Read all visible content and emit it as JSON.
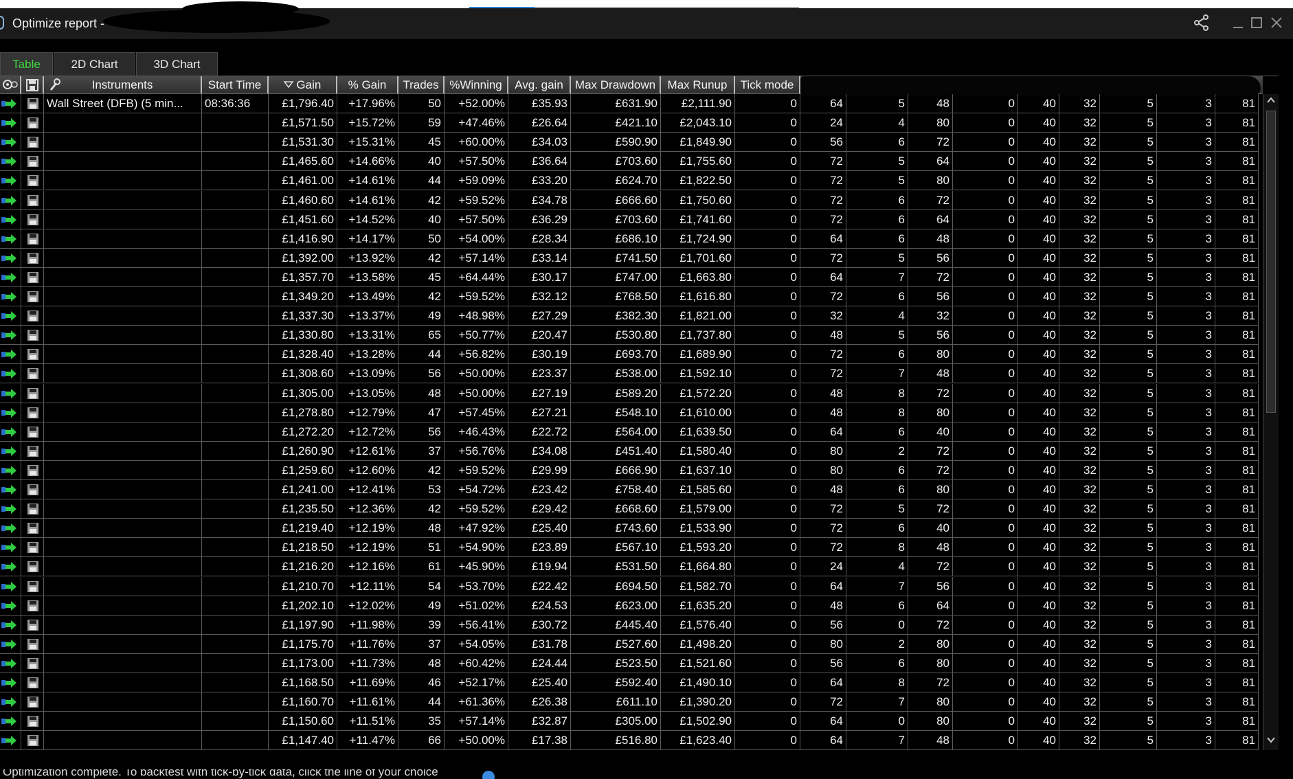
{
  "window": {
    "title": "Optimize report - "
  },
  "tabs": [
    {
      "label": "Table",
      "active": true
    },
    {
      "label": "2D Chart",
      "active": false
    },
    {
      "label": "3D Chart",
      "active": false
    }
  ],
  "columns": {
    "instruments": "Instruments",
    "start_time": "Start Time",
    "gain": "Gain",
    "pct_gain": "% Gain",
    "trades": "Trades",
    "pct_winning": "%Winning",
    "avg_gain": "Avg. gain",
    "max_drawdown": "Max Drawdown",
    "max_runup": "Max Runup",
    "tick_mode": "Tick mode"
  },
  "sort": {
    "column": "Gain",
    "direction": "descending"
  },
  "rows": [
    [
      "Wall Street (DFB) (5 min...",
      "08:36:36",
      "£1,796.40",
      "+17.96%",
      "50",
      "+52.00%",
      "£35.93",
      "£631.90",
      "£2,111.90",
      "0",
      "64",
      "5",
      "48",
      "0",
      "40",
      "32",
      "5",
      "3",
      "81"
    ],
    [
      "",
      "",
      "£1,571.50",
      "+15.72%",
      "59",
      "+47.46%",
      "£26.64",
      "£421.10",
      "£2,043.10",
      "0",
      "24",
      "4",
      "80",
      "0",
      "40",
      "32",
      "5",
      "3",
      "81"
    ],
    [
      "",
      "",
      "£1,531.30",
      "+15.31%",
      "45",
      "+60.00%",
      "£34.03",
      "£590.90",
      "£1,849.90",
      "0",
      "56",
      "6",
      "72",
      "0",
      "40",
      "32",
      "5",
      "3",
      "81"
    ],
    [
      "",
      "",
      "£1,465.60",
      "+14.66%",
      "40",
      "+57.50%",
      "£36.64",
      "£703.60",
      "£1,755.60",
      "0",
      "72",
      "5",
      "64",
      "0",
      "40",
      "32",
      "5",
      "3",
      "81"
    ],
    [
      "",
      "",
      "£1,461.00",
      "+14.61%",
      "44",
      "+59.09%",
      "£33.20",
      "£624.70",
      "£1,822.50",
      "0",
      "72",
      "5",
      "80",
      "0",
      "40",
      "32",
      "5",
      "3",
      "81"
    ],
    [
      "",
      "",
      "£1,460.60",
      "+14.61%",
      "42",
      "+59.52%",
      "£34.78",
      "£666.60",
      "£1,750.60",
      "0",
      "72",
      "6",
      "72",
      "0",
      "40",
      "32",
      "5",
      "3",
      "81"
    ],
    [
      "",
      "",
      "£1,451.60",
      "+14.52%",
      "40",
      "+57.50%",
      "£36.29",
      "£703.60",
      "£1,741.60",
      "0",
      "72",
      "6",
      "64",
      "0",
      "40",
      "32",
      "5",
      "3",
      "81"
    ],
    [
      "",
      "",
      "£1,416.90",
      "+14.17%",
      "50",
      "+54.00%",
      "£28.34",
      "£686.10",
      "£1,724.90",
      "0",
      "64",
      "6",
      "48",
      "0",
      "40",
      "32",
      "5",
      "3",
      "81"
    ],
    [
      "",
      "",
      "£1,392.00",
      "+13.92%",
      "42",
      "+57.14%",
      "£33.14",
      "£741.50",
      "£1,701.60",
      "0",
      "72",
      "5",
      "56",
      "0",
      "40",
      "32",
      "5",
      "3",
      "81"
    ],
    [
      "",
      "",
      "£1,357.70",
      "+13.58%",
      "45",
      "+64.44%",
      "£30.17",
      "£747.00",
      "£1,663.80",
      "0",
      "64",
      "7",
      "72",
      "0",
      "40",
      "32",
      "5",
      "3",
      "81"
    ],
    [
      "",
      "",
      "£1,349.20",
      "+13.49%",
      "42",
      "+59.52%",
      "£32.12",
      "£768.50",
      "£1,616.80",
      "0",
      "72",
      "6",
      "56",
      "0",
      "40",
      "32",
      "5",
      "3",
      "81"
    ],
    [
      "",
      "",
      "£1,337.30",
      "+13.37%",
      "49",
      "+48.98%",
      "£27.29",
      "£382.30",
      "£1,821.00",
      "0",
      "32",
      "4",
      "32",
      "0",
      "40",
      "32",
      "5",
      "3",
      "81"
    ],
    [
      "",
      "",
      "£1,330.80",
      "+13.31%",
      "65",
      "+50.77%",
      "£20.47",
      "£530.80",
      "£1,737.80",
      "0",
      "48",
      "5",
      "56",
      "0",
      "40",
      "32",
      "5",
      "3",
      "81"
    ],
    [
      "",
      "",
      "£1,328.40",
      "+13.28%",
      "44",
      "+56.82%",
      "£30.19",
      "£693.70",
      "£1,689.90",
      "0",
      "72",
      "6",
      "80",
      "0",
      "40",
      "32",
      "5",
      "3",
      "81"
    ],
    [
      "",
      "",
      "£1,308.60",
      "+13.09%",
      "56",
      "+50.00%",
      "£23.37",
      "£538.00",
      "£1,592.10",
      "0",
      "72",
      "7",
      "48",
      "0",
      "40",
      "32",
      "5",
      "3",
      "81"
    ],
    [
      "",
      "",
      "£1,305.00",
      "+13.05%",
      "48",
      "+50.00%",
      "£27.19",
      "£589.20",
      "£1,572.20",
      "0",
      "48",
      "8",
      "72",
      "0",
      "40",
      "32",
      "5",
      "3",
      "81"
    ],
    [
      "",
      "",
      "£1,278.80",
      "+12.79%",
      "47",
      "+57.45%",
      "£27.21",
      "£548.10",
      "£1,610.00",
      "0",
      "48",
      "8",
      "80",
      "0",
      "40",
      "32",
      "5",
      "3",
      "81"
    ],
    [
      "",
      "",
      "£1,272.20",
      "+12.72%",
      "56",
      "+46.43%",
      "£22.72",
      "£564.00",
      "£1,639.50",
      "0",
      "64",
      "6",
      "40",
      "0",
      "40",
      "32",
      "5",
      "3",
      "81"
    ],
    [
      "",
      "",
      "£1,260.90",
      "+12.61%",
      "37",
      "+56.76%",
      "£34.08",
      "£451.40",
      "£1,580.40",
      "0",
      "80",
      "2",
      "72",
      "0",
      "40",
      "32",
      "5",
      "3",
      "81"
    ],
    [
      "",
      "",
      "£1,259.60",
      "+12.60%",
      "42",
      "+59.52%",
      "£29.99",
      "£666.90",
      "£1,637.10",
      "0",
      "80",
      "6",
      "72",
      "0",
      "40",
      "32",
      "5",
      "3",
      "81"
    ],
    [
      "",
      "",
      "£1,241.00",
      "+12.41%",
      "53",
      "+54.72%",
      "£23.42",
      "£758.40",
      "£1,585.60",
      "0",
      "48",
      "6",
      "80",
      "0",
      "40",
      "32",
      "5",
      "3",
      "81"
    ],
    [
      "",
      "",
      "£1,235.50",
      "+12.36%",
      "42",
      "+59.52%",
      "£29.42",
      "£668.60",
      "£1,579.00",
      "0",
      "72",
      "5",
      "72",
      "0",
      "40",
      "32",
      "5",
      "3",
      "81"
    ],
    [
      "",
      "",
      "£1,219.40",
      "+12.19%",
      "48",
      "+47.92%",
      "£25.40",
      "£743.60",
      "£1,533.90",
      "0",
      "72",
      "6",
      "40",
      "0",
      "40",
      "32",
      "5",
      "3",
      "81"
    ],
    [
      "",
      "",
      "£1,218.50",
      "+12.19%",
      "51",
      "+54.90%",
      "£23.89",
      "£567.10",
      "£1,593.20",
      "0",
      "72",
      "8",
      "48",
      "0",
      "40",
      "32",
      "5",
      "3",
      "81"
    ],
    [
      "",
      "",
      "£1,216.20",
      "+12.16%",
      "61",
      "+45.90%",
      "£19.94",
      "£531.50",
      "£1,664.80",
      "0",
      "24",
      "4",
      "72",
      "0",
      "40",
      "32",
      "5",
      "3",
      "81"
    ],
    [
      "",
      "",
      "£1,210.70",
      "+12.11%",
      "54",
      "+53.70%",
      "£22.42",
      "£694.50",
      "£1,582.70",
      "0",
      "64",
      "7",
      "56",
      "0",
      "40",
      "32",
      "5",
      "3",
      "81"
    ],
    [
      "",
      "",
      "£1,202.10",
      "+12.02%",
      "49",
      "+51.02%",
      "£24.53",
      "£623.00",
      "£1,635.20",
      "0",
      "48",
      "6",
      "64",
      "0",
      "40",
      "32",
      "5",
      "3",
      "81"
    ],
    [
      "",
      "",
      "£1,197.90",
      "+11.98%",
      "39",
      "+56.41%",
      "£30.72",
      "£445.40",
      "£1,576.40",
      "0",
      "56",
      "0",
      "72",
      "0",
      "40",
      "32",
      "5",
      "3",
      "81"
    ],
    [
      "",
      "",
      "£1,175.70",
      "+11.76%",
      "37",
      "+54.05%",
      "£31.78",
      "£527.60",
      "£1,498.20",
      "0",
      "80",
      "2",
      "80",
      "0",
      "40",
      "32",
      "5",
      "3",
      "81"
    ],
    [
      "",
      "",
      "£1,173.00",
      "+11.73%",
      "48",
      "+60.42%",
      "£24.44",
      "£523.50",
      "£1,521.60",
      "0",
      "56",
      "6",
      "80",
      "0",
      "40",
      "32",
      "5",
      "3",
      "81"
    ],
    [
      "",
      "",
      "£1,168.50",
      "+11.69%",
      "46",
      "+52.17%",
      "£25.40",
      "£592.40",
      "£1,490.10",
      "0",
      "64",
      "8",
      "72",
      "0",
      "40",
      "32",
      "5",
      "3",
      "81"
    ],
    [
      "",
      "",
      "£1,160.70",
      "+11.61%",
      "44",
      "+61.36%",
      "£26.38",
      "£611.10",
      "£1,390.20",
      "0",
      "72",
      "7",
      "80",
      "0",
      "40",
      "32",
      "5",
      "3",
      "81"
    ],
    [
      "",
      "",
      "£1,150.60",
      "+11.51%",
      "35",
      "+57.14%",
      "£32.87",
      "£305.00",
      "£1,502.90",
      "0",
      "64",
      "0",
      "80",
      "0",
      "40",
      "32",
      "5",
      "3",
      "81"
    ],
    [
      "",
      "",
      "£1,147.40",
      "+11.47%",
      "66",
      "+50.00%",
      "£17.38",
      "£516.80",
      "£1,623.40",
      "0",
      "64",
      "7",
      "48",
      "0",
      "40",
      "32",
      "5",
      "3",
      "81"
    ]
  ],
  "status": {
    "text": "Optimization complete.   To backtest with tick-by-tick data, click the line of your choice"
  },
  "colors": {
    "active_tab_text": "#3ddc3d",
    "go_arrow": "#2ecc40",
    "background": "#000000"
  },
  "icons": {
    "share": "share-icon",
    "minimize": "minimize-icon",
    "maximize": "maximize-icon",
    "close": "close-icon"
  }
}
